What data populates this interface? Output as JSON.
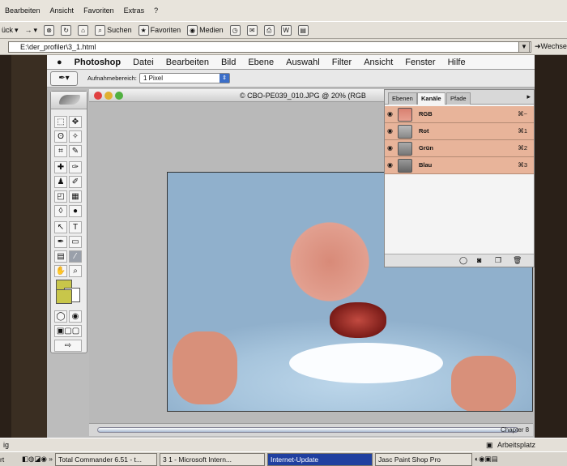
{
  "ie_menu": [
    "Bearbeiten",
    "Ansicht",
    "Favoriten",
    "Extras",
    "?"
  ],
  "ie_toolbar": {
    "back": "ück",
    "search": "Suchen",
    "favorites": "Favoriten",
    "media": "Medien"
  },
  "address": {
    "value": "E:\\der_profiler\\3_1.html",
    "goto": "Wechse"
  },
  "mac_menu": {
    "app": "Photoshop",
    "items": [
      "Datei",
      "Bearbeiten",
      "Bild",
      "Ebene",
      "Auswahl",
      "Filter",
      "Ansicht",
      "Fenster",
      "Hilfe"
    ]
  },
  "options_bar": {
    "label": "Aufnahmebereich:",
    "value": "1 Pixel"
  },
  "document": {
    "title": "© CBO-PE039_010.JPG @ 20% (RGB"
  },
  "channels_panel": {
    "tabs": [
      "Ebenen",
      "Kanäle",
      "Pfade"
    ],
    "active_tab": "Kanäle",
    "channels": [
      {
        "name": "RGB",
        "key": "⌘~"
      },
      {
        "name": "Rot",
        "key": "⌘1"
      },
      {
        "name": "Grün",
        "key": "⌘2"
      },
      {
        "name": "Blau",
        "key": "⌘3"
      }
    ]
  },
  "dock_label": "Chapter 8",
  "status_strip": {
    "left": "ig",
    "right": "Arbeitsplatz"
  },
  "taskbar": {
    "items": [
      {
        "label": "Total Commander 6.51 - t...",
        "active": false
      },
      {
        "label": "3  1 - Microsoft Intern...",
        "active": false
      },
      {
        "label": "Internet-Update",
        "active": true
      },
      {
        "label": "Jasc Paint Shop Pro",
        "active": false
      }
    ]
  },
  "colors": {
    "foreground": "#c8c64a",
    "channel_highlight": "#e8b49a"
  }
}
